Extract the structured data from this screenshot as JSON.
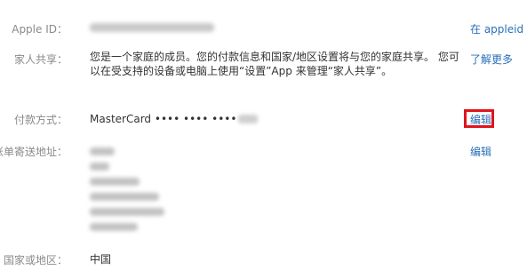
{
  "rows": {
    "apple_id": {
      "label": "Apple ID：",
      "link": "在 appleid"
    },
    "family_sharing": {
      "label": "家人共享：",
      "text": "您是一个家庭的成员。您的付款信息和国家/地区设置将与您的家庭共享。 您可以在受支持的设备或电脑上使用“设置”App 来管理“家人共享”。",
      "link": "了解更多"
    },
    "payment": {
      "label": "付款方式：",
      "card": "MasterCard •••• •••• ••••",
      "link": "编辑"
    },
    "billing_address": {
      "label": "账单寄送地址：",
      "link": "编辑"
    },
    "country": {
      "label": "国家或地区：",
      "value": "中国"
    }
  },
  "colors": {
    "label": "#8a8a8a",
    "text": "#333333",
    "link": "#2b6fb8",
    "highlight": "#e0141e"
  }
}
